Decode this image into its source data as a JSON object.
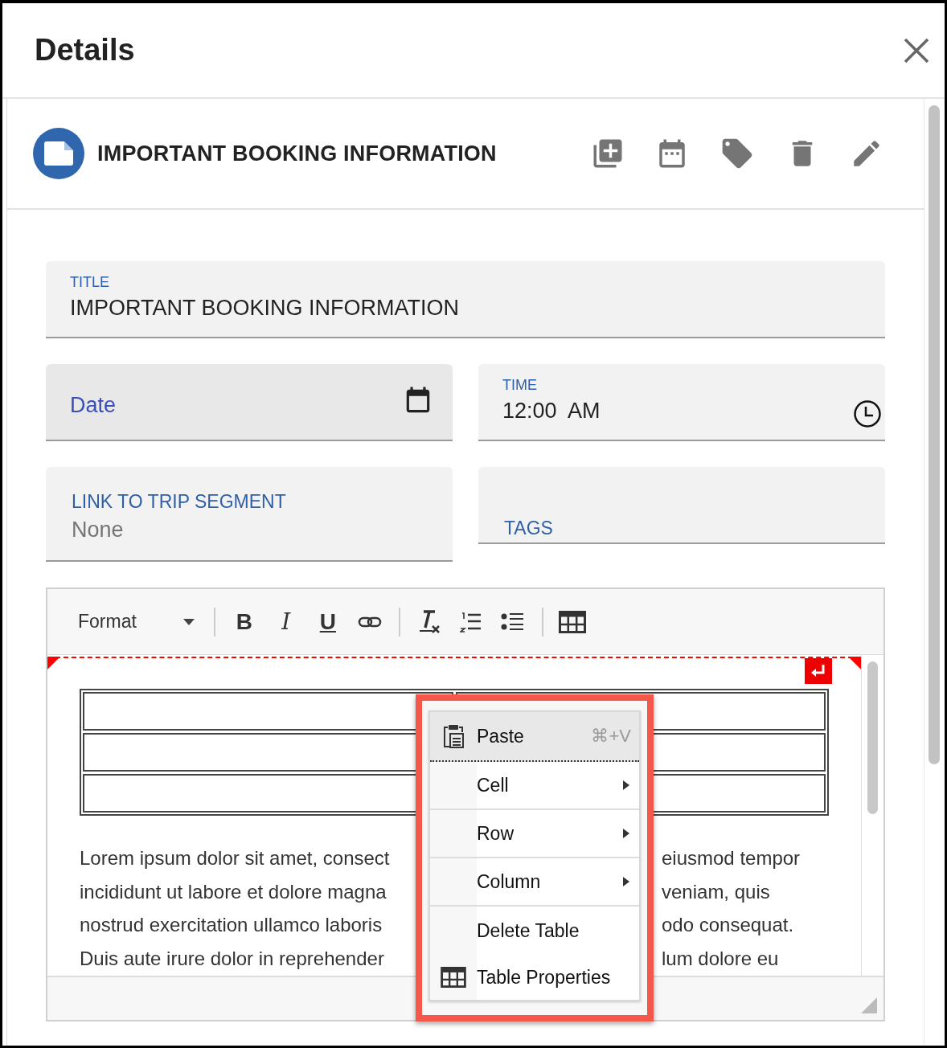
{
  "dialog": {
    "title": "Details"
  },
  "record": {
    "title": "IMPORTANT BOOKING INFORMATION",
    "actions": [
      {
        "kind": "add"
      },
      {
        "kind": "calendar"
      },
      {
        "kind": "tag"
      },
      {
        "kind": "delete"
      },
      {
        "kind": "edit"
      }
    ]
  },
  "fields": [
    {
      "kind": "text",
      "label": "TITLE",
      "value": "IMPORTANT BOOKING INFORMATION"
    },
    {
      "kind": "date",
      "placeholder": "Date"
    },
    {
      "kind": "time",
      "label": "TIME",
      "value": "12:00  AM"
    },
    {
      "kind": "select",
      "label": "LINK TO TRIP SEGMENT",
      "value": "None"
    },
    {
      "kind": "tags",
      "label": "TAGS"
    }
  ],
  "editor": {
    "format_label": "Format",
    "toolbar": [
      {
        "kind": "bold",
        "label": "B"
      },
      {
        "kind": "italic",
        "label": "I"
      },
      {
        "kind": "underline",
        "label": "U"
      },
      {
        "kind": "link"
      },
      {
        "kind": "separator"
      },
      {
        "kind": "clear-format"
      },
      {
        "kind": "numbered-list"
      },
      {
        "kind": "bulleted-list"
      },
      {
        "kind": "separator"
      },
      {
        "kind": "table"
      }
    ],
    "paragraph_lines": [
      {
        "left": "Lorem ipsum dolor sit amet, consect",
        "right": "eiusmod tempor"
      },
      {
        "left": "incididunt ut labore et dolore magna",
        "right": "veniam, quis"
      },
      {
        "left": "nostrud exercitation ullamco laboris",
        "right": "odo consequat."
      },
      {
        "left": "Duis aute irure dolor in reprehender",
        "right": "lum dolore eu"
      }
    ]
  },
  "context_menu": {
    "items": [
      {
        "label": "Paste",
        "shortcut": "⌘+V",
        "kind": "paste",
        "submenu": false,
        "selected": true
      },
      {
        "label": "Cell",
        "submenu": true,
        "selected": false
      },
      {
        "label": "Row",
        "submenu": true,
        "selected": false
      },
      {
        "label": "Column",
        "submenu": true,
        "selected": false
      },
      {
        "label": "Delete Table",
        "submenu": false,
        "selected": false
      },
      {
        "label": "Table Properties",
        "kind": "table",
        "submenu": false,
        "selected": false
      }
    ]
  }
}
